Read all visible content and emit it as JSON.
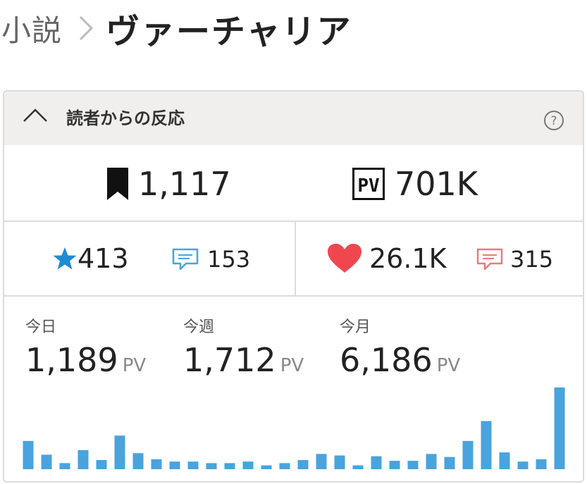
{
  "breadcrumb": {
    "parent": "小説",
    "title": "ヴァーチャリア"
  },
  "reactions": {
    "header": "読者からの反応",
    "bookmarks": "1,117",
    "pv_total": "701K",
    "pv_badge": "PV",
    "stars": "413",
    "reviews": "153",
    "hearts": "26.1K",
    "comments": "315"
  },
  "pv": {
    "unit": "PV",
    "today": {
      "label": "今日",
      "value": "1,189"
    },
    "week": {
      "label": "今週",
      "value": "1,712"
    },
    "month": {
      "label": "今月",
      "value": "6,186"
    }
  },
  "chart_data": {
    "type": "bar",
    "values": [
      37,
      19,
      8,
      25,
      12,
      44,
      21,
      13,
      10,
      10,
      8,
      8,
      10,
      5,
      8,
      12,
      20,
      18,
      5,
      17,
      11,
      11,
      20,
      16,
      37,
      63,
      22,
      10,
      13,
      107
    ],
    "color": "#4aa3dc"
  },
  "colors": {
    "star": "#1f8bd2",
    "heart": "#f0474f",
    "review_icon": "#4aa3dc",
    "comment_icon": "#e97b7b"
  }
}
